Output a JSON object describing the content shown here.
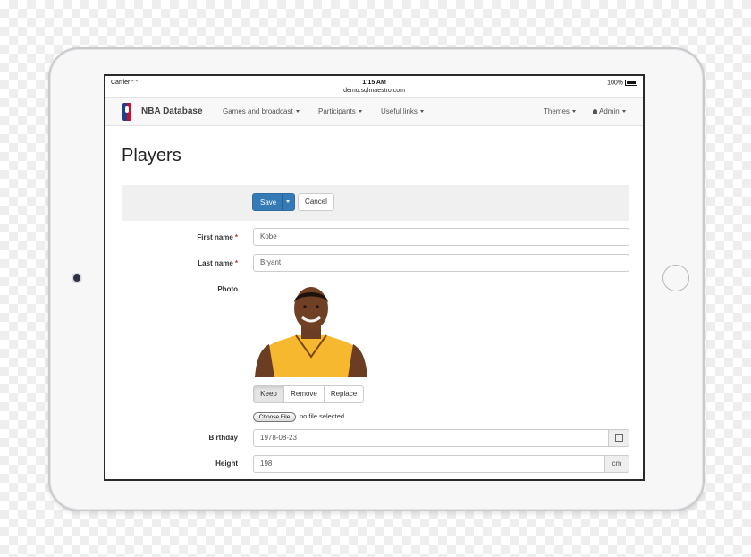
{
  "status_bar": {
    "carrier": "Carrier",
    "time": "1:15 AM",
    "url": "demo.sqlmaestro.com",
    "battery": "100%"
  },
  "navbar": {
    "brand": "NBA Database",
    "items": [
      "Games and broadcast",
      "Participants",
      "Useful links"
    ],
    "themes": "Themes",
    "user": "Admin"
  },
  "page": {
    "title": "Players"
  },
  "toolbar": {
    "save_label": "Save",
    "cancel_label": "Cancel"
  },
  "form": {
    "first_name": {
      "label": "First name",
      "required": "*",
      "value": "Kobe"
    },
    "last_name": {
      "label": "Last name",
      "required": "*",
      "value": "Bryant"
    },
    "photo": {
      "label": "Photo",
      "buttons": [
        "Keep",
        "Remove",
        "Replace"
      ],
      "file_button": "Choose File",
      "file_status": "no file selected"
    },
    "birthday": {
      "label": "Birthday",
      "value": "1978-08-23"
    },
    "height": {
      "label": "Height",
      "value": "198",
      "unit": "cm"
    }
  },
  "colors": {
    "primary": "#337ab7",
    "required": "#c9302c",
    "jersey": "#f6b82f"
  },
  "icons": {
    "calendar": "calendar-icon",
    "user": "user-icon",
    "wifi": "wifi-icon",
    "battery": "battery-icon"
  }
}
